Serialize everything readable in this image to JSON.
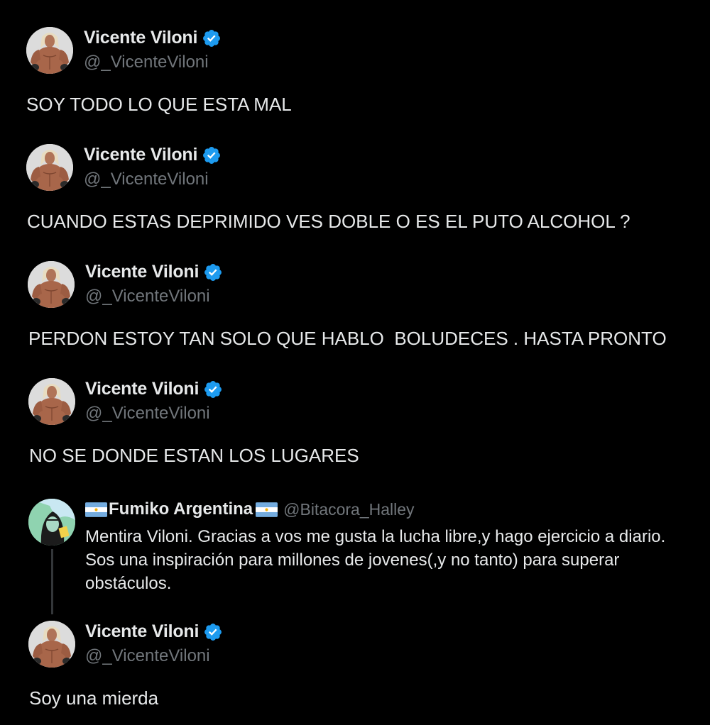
{
  "tweets": [
    {
      "display_name": "Vicente Viloni",
      "handle": "@_VicenteViloni",
      "verified_icon": "verified-badge-icon",
      "text": "SOY TODO LO QUE ESTA MAL"
    },
    {
      "display_name": "Vicente Viloni",
      "handle": "@_VicenteViloni",
      "verified_icon": "verified-badge-icon",
      "text": "CUANDO ESTAS DEPRIMIDO VES DOBLE O ES EL PUTO ALCOHOL ?"
    },
    {
      "display_name": "Vicente Viloni",
      "handle": "@_VicenteViloni",
      "verified_icon": "verified-badge-icon",
      "text": "PERDON ESTOY TAN SOLO QUE HABLO  BOLUDECES . HASTA PRONTO"
    },
    {
      "display_name": "Vicente Viloni",
      "handle": "@_VicenteViloni",
      "verified_icon": "verified-badge-icon",
      "text": "NO SE DONDE ESTAN LOS LUGARES"
    },
    {
      "display_name": "Vicente Viloni",
      "handle": "@_VicenteViloni",
      "verified_icon": "verified-badge-icon",
      "text": "Soy una mierda"
    }
  ],
  "reply": {
    "display_name": "Fumiko Argentina",
    "handle": "@Bitacora_Halley",
    "flag_icon": "argentina-flag-icon",
    "text": "Mentira Viloni. Gracias a vos me gusta la lucha libre,y hago ejercicio a diario. Sos una inspiración para millones de jovenes(,y no tanto) para superar obstáculos."
  },
  "colors": {
    "background": "#000000",
    "primary_text": "#e7e9ea",
    "secondary_text": "#71767b",
    "verified_blue": "#1d9bf0",
    "thread_line": "#333639"
  }
}
